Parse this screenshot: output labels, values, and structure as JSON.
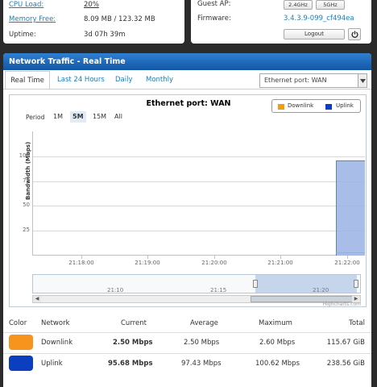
{
  "status": {
    "cpu_label": "CPU Load:",
    "cpu_value": "20%",
    "mem_label": "Memory Free:",
    "mem_value": "8.09 MB / 123.32 MB",
    "uptime_label": "Uptime:",
    "uptime_value": "3d 07h 39m",
    "guest_label": "Guest AP:",
    "guest_24": "2.4GHz",
    "guest_5": "5GHz",
    "firmware_label": "Firmware:",
    "firmware_value": "3.4.3.9-099_cf494ea",
    "logout_label": "Logout"
  },
  "panel": {
    "title": "Network Traffic - Real Time",
    "tabs": [
      "Real Time",
      "Last 24 Hours",
      "Daily",
      "Monthly"
    ],
    "port_select": "Ethernet port: WAN"
  },
  "chart_data": {
    "type": "area",
    "title": "Ethernet port: WAN",
    "ylabel": "Bandwidth (Mbps)",
    "ylim": [
      0,
      125
    ],
    "yticks": [
      "25",
      "50",
      "75",
      "100"
    ],
    "x_ticks": [
      "21:18:00",
      "21:19:00",
      "21:20:00",
      "21:21:00",
      "21:22:00"
    ],
    "period_label": "Period",
    "periods": [
      "1M",
      "5M",
      "15M",
      "All"
    ],
    "selected_period": "5M",
    "series": [
      {
        "name": "Downlink",
        "color": "#f39c12",
        "values": [
          0,
          0,
          0,
          0,
          0,
          0,
          0,
          2.5
        ]
      },
      {
        "name": "Uplink",
        "color": "#0b3fbf",
        "values": [
          0,
          0,
          0,
          0,
          0,
          0,
          0,
          95.7
        ]
      }
    ],
    "grid": true,
    "legend_position": "top-right",
    "navigator_ticks": [
      "21:10",
      "21:15",
      "21:20"
    ],
    "credits": "Highcharts.com"
  },
  "stats": {
    "headers": [
      "Color",
      "Network",
      "Current",
      "Average",
      "Maximum",
      "Total"
    ],
    "rows": [
      {
        "color": "#f7941d",
        "network": "Downlink",
        "current": "2.50 Mbps",
        "average": "2.50 Mbps",
        "maximum": "2.60 Mbps",
        "total": "115.67 GiB"
      },
      {
        "color": "#0b3fbf",
        "network": "Uplink",
        "current": "95.68 Mbps",
        "average": "97.43 Mbps",
        "maximum": "100.62 Mbps",
        "total": "238.56 GiB"
      }
    ]
  }
}
